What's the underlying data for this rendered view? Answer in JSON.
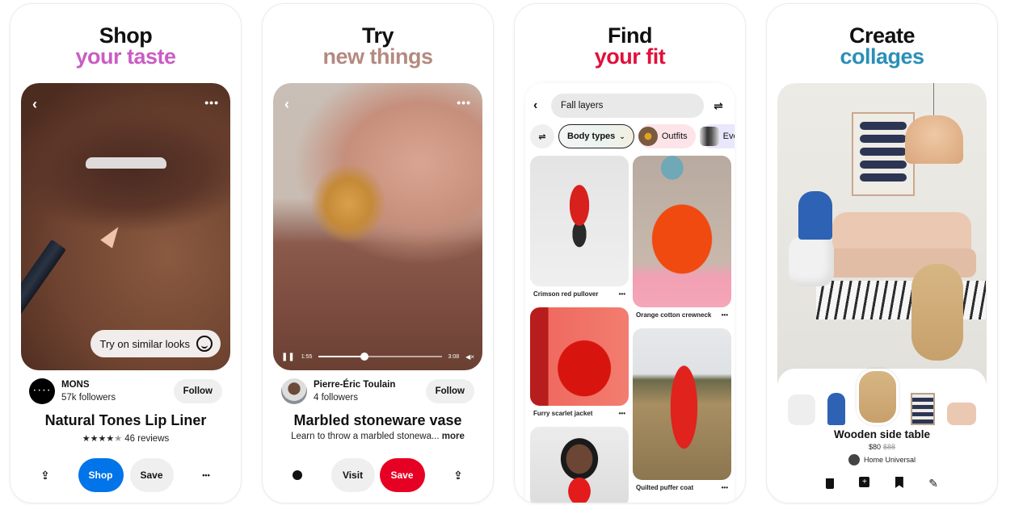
{
  "panels": [
    {
      "headline": {
        "line1": "Shop",
        "line2": "your taste",
        "accent": "#c95dc4"
      },
      "hero": {
        "back_icon": "‹",
        "more_icon": "•••",
        "overlay_chip": "Try on similar looks"
      },
      "creator": {
        "name": "MONS",
        "followers": "57k followers",
        "follow_label": "Follow"
      },
      "title": "Natural Tones Lip Liner",
      "rating": {
        "stars_filled": 4,
        "stars_total": 5,
        "reviews": "46 reviews"
      },
      "actions": {
        "share_icon": "⇪",
        "primary_label": "Shop",
        "save_label": "Save",
        "more_icon": "•••"
      }
    },
    {
      "headline": {
        "line1": "Try",
        "line2": "new things",
        "accent": "#b48a80"
      },
      "hero": {
        "back_icon": "‹",
        "more_icon": "•••"
      },
      "video": {
        "pause_icon": "❚❚",
        "elapsed": "1:55",
        "duration": "3:08",
        "progress": 0.37,
        "mute_icon": "◀×"
      },
      "creator": {
        "name": "Pierre-Éric Toulain",
        "followers": "4 followers",
        "follow_label": "Follow"
      },
      "title": "Marbled stoneware vase",
      "description": "Learn to throw a marbled stonewa...",
      "more_link": "more",
      "actions": {
        "comment_icon": "💬",
        "visit_label": "Visit",
        "save_label": "Save",
        "share_icon": "⇪"
      }
    },
    {
      "headline": {
        "line1": "Find",
        "line2": "your fit",
        "accent": "#e0103a"
      },
      "search": {
        "back_icon": "‹",
        "value": "Fall layers",
        "filter_icon": "⚙"
      },
      "chips": [
        {
          "label": "",
          "type": "filter"
        },
        {
          "label": "Body types",
          "type": "dropdown",
          "chevron": "⌄"
        },
        {
          "label": "Outfits",
          "type": "image"
        },
        {
          "label": "Every",
          "type": "image"
        }
      ],
      "pins": [
        {
          "caption": "Crimson red pullover",
          "more": "•••"
        },
        {
          "caption": "Orange cotton crewneck",
          "more": "•••"
        },
        {
          "caption": "Furry scarlet jacket",
          "more": "•••"
        },
        {
          "caption": "Quilted puffer coat",
          "more": "•••"
        },
        {
          "caption": "",
          "more": ""
        }
      ]
    },
    {
      "headline": {
        "line1": "Create",
        "line2": "collages",
        "accent": "#2a8fb8"
      },
      "product": {
        "title": "Wooden side table",
        "price": "$80",
        "original_price": "$88",
        "store": "Home Universal"
      },
      "tools": {
        "delete_icon": "🗑",
        "duplicate_icon": "⧉",
        "bookmark_icon": "🔖",
        "edit_icon": "✎"
      }
    }
  ]
}
